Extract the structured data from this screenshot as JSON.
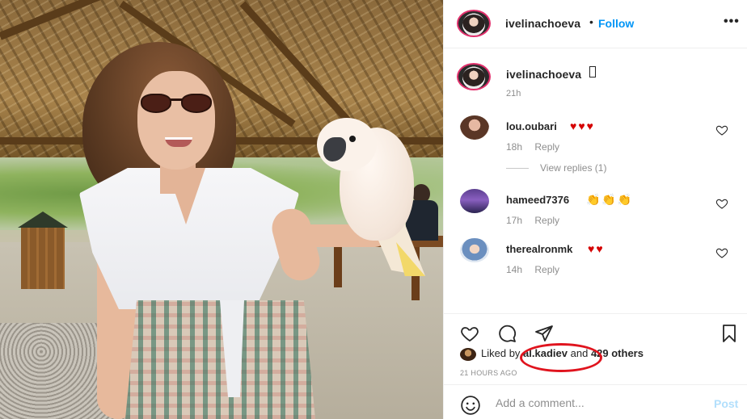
{
  "post_header": {
    "username": "ivelinachoeva",
    "separator": "•",
    "follow_label": "Follow",
    "more_label": "•••"
  },
  "caption": {
    "username": "ivelinachoeva",
    "time": "21h"
  },
  "comments": [
    {
      "username": "lou.oubari",
      "text": "♥♥♥",
      "time": "18h",
      "reply_label": "Reply"
    },
    {
      "username": "hameed7376",
      "text": "👏👏👏",
      "time": "17h",
      "reply_label": "Reply"
    },
    {
      "username": "therealronmk",
      "text": "♥♥",
      "time": "14h",
      "reply_label": "Reply"
    }
  ],
  "view_replies_label": "View replies (1)",
  "likes": {
    "prefix": "Liked by",
    "user": "al.kadiev",
    "conjunction": "and",
    "others": "429 others"
  },
  "posted_time": "21 HOURS AGO",
  "comment_box": {
    "placeholder": "Add a comment...",
    "post_label": "Post"
  },
  "icons": [
    "heart-icon",
    "comment-icon",
    "share-icon",
    "bookmark-icon",
    "smiley-icon"
  ],
  "colors": {
    "follow": "#0095f6",
    "annotation_circle": "#e0141e",
    "post_disabled": "#b2dffc",
    "heart_emoji": "#d50000"
  }
}
